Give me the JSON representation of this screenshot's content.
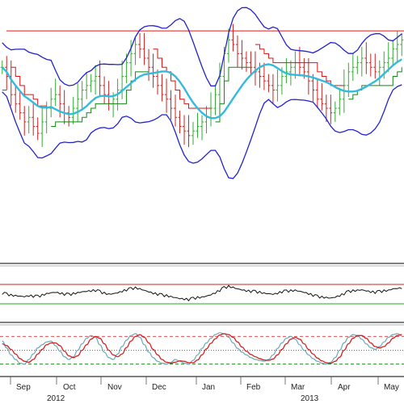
{
  "colors": {
    "background": "#ffffff",
    "price_bar_up": "#33aa33",
    "price_bar_down": "#cc2222",
    "band": "#2222cc",
    "moving_average": "#33bbdd",
    "trailing_stop_up": "#118811",
    "trailing_stop_down": "#dd1111",
    "resistance": "#ee3333",
    "rsi_line": "#111111",
    "rsi_upper": "#cc2222",
    "rsi_lower": "#22aa22",
    "stoch_k": "#6ba7b5",
    "stoch_d": "#d62020",
    "stoch_upper": "#e05050",
    "stoch_mid": "#6666aa",
    "stoch_lower": "#228822",
    "panel_border": "#333333"
  },
  "chart_data": [
    {
      "type": "line",
      "panel": "price",
      "description_series": [
        "price bars",
        "upper band",
        "lower band",
        "moving average",
        "trailing stop",
        "resistance line"
      ],
      "x_labels": [
        "Sep",
        "Oct",
        "Nov",
        "Dec",
        "Jan",
        "Feb",
        "Mar",
        "Apr",
        "May"
      ],
      "year_labels": [
        "2012",
        "2013"
      ],
      "resistance_level": 100,
      "ylim": [
        0,
        110
      ],
      "close": [
        84,
        80,
        72,
        68,
        64,
        60,
        62,
        58,
        55,
        60,
        66,
        70,
        72,
        68,
        64,
        62,
        66,
        70,
        74,
        76,
        78,
        80,
        76,
        72,
        68,
        70,
        74,
        80,
        86,
        90,
        94,
        92,
        88,
        84,
        80,
        76,
        72,
        70,
        66,
        62,
        58,
        56,
        54,
        56,
        58,
        60,
        62,
        66,
        72,
        80,
        90,
        96,
        94,
        90,
        88,
        86,
        84,
        82,
        80,
        78,
        76,
        74,
        76,
        80,
        82,
        84,
        86,
        84,
        82,
        78,
        74,
        70,
        68,
        66,
        64,
        66,
        70,
        76,
        82,
        84,
        86,
        88,
        86,
        84,
        82,
        84,
        86,
        88,
        92,
        94,
        96
      ]
    },
    {
      "type": "line",
      "panel": "rsi",
      "ylim": [
        0,
        100
      ],
      "upper_level": 70,
      "lower_level": 30,
      "values": [
        52,
        50,
        48,
        47,
        46,
        45,
        47,
        46,
        45,
        48,
        51,
        53,
        54,
        52,
        50,
        49,
        51,
        53,
        55,
        56,
        57,
        58,
        55,
        52,
        50,
        51,
        53,
        56,
        59,
        61,
        63,
        61,
        58,
        55,
        52,
        50,
        48,
        47,
        45,
        43,
        41,
        40,
        39,
        41,
        43,
        44,
        46,
        49,
        53,
        58,
        63,
        66,
        64,
        61,
        59,
        57,
        56,
        55,
        54,
        52,
        51,
        50,
        52,
        55,
        56,
        57,
        58,
        56,
        54,
        51,
        48,
        45,
        44,
        43,
        42,
        44,
        47,
        51,
        55,
        57,
        58,
        59,
        57,
        55,
        54,
        55,
        57,
        58,
        61,
        62,
        63
      ]
    },
    {
      "type": "line",
      "panel": "stochastic",
      "ylim": [
        0,
        100
      ],
      "upper_level": 80,
      "mid_level": 50,
      "lower_level": 20,
      "k": [
        70,
        55,
        40,
        30,
        22,
        20,
        30,
        42,
        55,
        62,
        68,
        70,
        60,
        48,
        36,
        30,
        36,
        50,
        64,
        76,
        82,
        78,
        62,
        46,
        34,
        30,
        42,
        58,
        72,
        82,
        86,
        78,
        62,
        46,
        34,
        26,
        22,
        20,
        24,
        30,
        26,
        22,
        20,
        28,
        40,
        54,
        66,
        76,
        84,
        88,
        86,
        78,
        66,
        54,
        46,
        40,
        34,
        30,
        28,
        26,
        30,
        40,
        54,
        66,
        76,
        80,
        74,
        62,
        50,
        40,
        32,
        26,
        22,
        20,
        24,
        34,
        50,
        66,
        78,
        84,
        82,
        74,
        64,
        56,
        52,
        58,
        68,
        78,
        84,
        86,
        82
      ],
      "d": [
        64,
        60,
        52,
        42,
        32,
        26,
        24,
        30,
        42,
        52,
        62,
        66,
        66,
        60,
        48,
        38,
        34,
        38,
        50,
        62,
        74,
        80,
        76,
        64,
        50,
        40,
        36,
        42,
        56,
        70,
        80,
        84,
        78,
        66,
        52,
        40,
        30,
        24,
        22,
        24,
        27,
        26,
        23,
        23,
        29,
        40,
        53,
        65,
        75,
        83,
        86,
        84,
        78,
        68,
        57,
        48,
        41,
        36,
        32,
        29,
        28,
        31,
        40,
        52,
        64,
        74,
        78,
        74,
        64,
        52,
        42,
        33,
        27,
        23,
        22,
        26,
        35,
        50,
        64,
        76,
        82,
        82,
        76,
        66,
        58,
        55,
        58,
        66,
        76,
        82,
        84
      ]
    }
  ]
}
